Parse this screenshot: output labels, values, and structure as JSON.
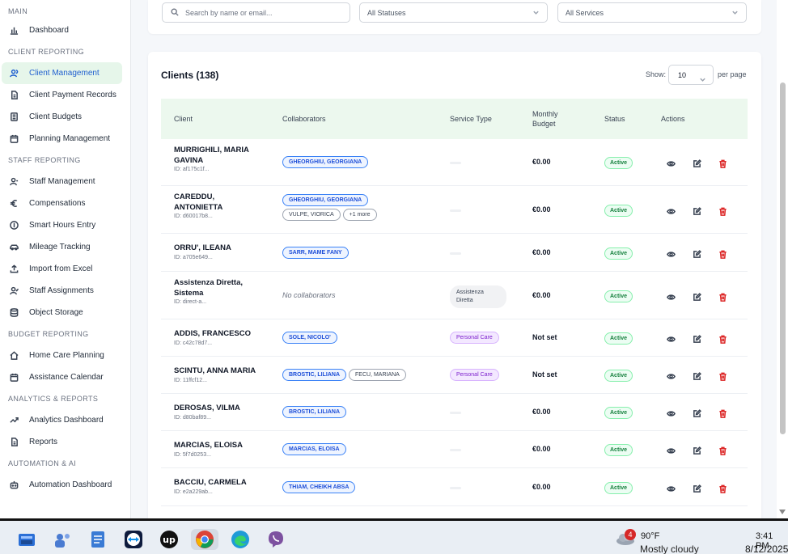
{
  "sidebar": {
    "sections": [
      {
        "title": "MAIN",
        "items": [
          {
            "label": "Dashboard",
            "icon": "chart-icon"
          }
        ]
      },
      {
        "title": "CLIENT REPORTING",
        "items": [
          {
            "label": "Client Management",
            "icon": "users-icon",
            "active": true
          },
          {
            "label": "Client Payment Records",
            "icon": "document-icon"
          },
          {
            "label": "Client Budgets",
            "icon": "calculator-icon"
          },
          {
            "label": "Planning Management",
            "icon": "calendar-icon"
          }
        ]
      },
      {
        "title": "STAFF REPORTING",
        "items": [
          {
            "label": "Staff Management",
            "icon": "user-icon"
          },
          {
            "label": "Compensations",
            "icon": "euro-icon"
          },
          {
            "label": "Smart Hours Entry",
            "icon": "clock-icon"
          },
          {
            "label": "Mileage Tracking",
            "icon": "car-icon"
          },
          {
            "label": "Import from Excel",
            "icon": "upload-icon"
          },
          {
            "label": "Staff Assignments",
            "icon": "user-check-icon"
          },
          {
            "label": "Object Storage",
            "icon": "database-icon"
          }
        ]
      },
      {
        "title": "BUDGET REPORTING",
        "items": [
          {
            "label": "Home Care Planning",
            "icon": "home-icon"
          },
          {
            "label": "Assistance Calendar",
            "icon": "calendar-icon"
          }
        ]
      },
      {
        "title": "ANALYTICS & REPORTS",
        "items": [
          {
            "label": "Analytics Dashboard",
            "icon": "trend-icon"
          },
          {
            "label": "Reports",
            "icon": "document-icon"
          }
        ]
      },
      {
        "title": "AUTOMATION & AI",
        "items": [
          {
            "label": "Automation Dashboard",
            "icon": "bot-icon"
          }
        ]
      }
    ]
  },
  "filters": {
    "search_placeholder": "Search by name or email...",
    "status_value": "All Statuses",
    "service_value": "All Services"
  },
  "clients": {
    "title": "Clients (138)",
    "show_label": "Show:",
    "per_page_value": "10",
    "per_page_label": "per page",
    "headers": {
      "client": "Client",
      "collaborators": "Collaborators",
      "service_type": "Service Type",
      "monthly_budget": "Monthly Budget",
      "status": "Status",
      "actions": "Actions"
    },
    "rows": [
      {
        "name": "MURRIGHILI, MARIA GAVINA",
        "id": "ID: af175c1f...",
        "collaborators": [
          {
            "text": "GHEORGHIU, GEORGIANA",
            "style": "blue"
          }
        ],
        "service": "",
        "budget": "€0.00",
        "status": "Active"
      },
      {
        "name": "CAREDDU, ANTONIETTA",
        "id": "ID: d60017b8...",
        "collaborators": [
          {
            "text": "GHEORGHIU, GEORGIANA",
            "style": "blue"
          },
          {
            "text": "VULPE, VIORICA",
            "style": "gray"
          },
          {
            "text": "+1 more",
            "style": "gray"
          }
        ],
        "service": "",
        "budget": "€0.00",
        "status": "Active"
      },
      {
        "name": "ORRU', ILEANA",
        "id": "ID: a705e649...",
        "collaborators": [
          {
            "text": "SARR, MAME FANY",
            "style": "blue"
          }
        ],
        "service": "",
        "budget": "€0.00",
        "status": "Active"
      },
      {
        "name": "Assistenza Diretta, Sistema",
        "id": "ID: direct-a...",
        "collaborators": [],
        "no_collaborators": "No collaborators",
        "service": "Assistenza Diretta",
        "service_style": "ad",
        "budget": "€0.00",
        "status": "Active"
      },
      {
        "name": "ADDIS, FRANCESCO",
        "id": "ID: c42c78d7...",
        "collaborators": [
          {
            "text": "SOLE, NICOLO'",
            "style": "blue"
          }
        ],
        "service": "Personal Care",
        "service_style": "pc",
        "budget": "Not set",
        "status": "Active"
      },
      {
        "name": "SCINTU, ANNA MARIA",
        "id": "ID: 11ffcf12...",
        "collaborators": [
          {
            "text": "BROSTIC, LILIANA",
            "style": "blue"
          },
          {
            "text": "FECU, MARIANA",
            "style": "gray"
          }
        ],
        "service": "Personal Care",
        "service_style": "pc",
        "budget": "Not set",
        "status": "Active"
      },
      {
        "name": "DEROSAS, VILMA",
        "id": "ID: d80baf89...",
        "collaborators": [
          {
            "text": "BROSTIC, LILIANA",
            "style": "blue"
          }
        ],
        "service": "",
        "budget": "€0.00",
        "status": "Active"
      },
      {
        "name": "MARCIAS, ELOISA",
        "id": "ID: 5f7d0253...",
        "collaborators": [
          {
            "text": "MARCIAS, ELOISA",
            "style": "blue"
          }
        ],
        "service": "",
        "budget": "€0.00",
        "status": "Active"
      },
      {
        "name": "BACCIU, CARMELA",
        "id": "ID: e2a229ab...",
        "collaborators": [
          {
            "text": "THIAM, CHEIKH ABSA",
            "style": "blue"
          }
        ],
        "service": "",
        "budget": "€0.00",
        "status": "Active"
      }
    ]
  },
  "taskbar": {
    "apps": [
      "explorer-icon",
      "teams-icon",
      "notepad-icon",
      "teamviewer-icon",
      "upwork-icon",
      "chrome-icon",
      "edge-icon",
      "viber-icon"
    ],
    "weather_badge": "4",
    "temperature": "90°F",
    "weather_desc": "Mostly cloudy",
    "time": "3:41 PM",
    "date": "8/12/2025"
  },
  "colors": {
    "accent": "#1f5fcf",
    "active_nav_bg": "#e6f6ea",
    "table_header_bg": "#ecf8ee",
    "status_active": "#15803d",
    "delete": "#dc2626"
  }
}
